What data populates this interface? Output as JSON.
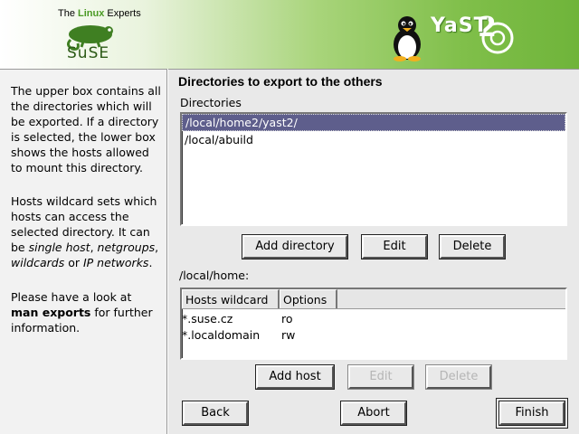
{
  "header": {
    "tagline_pre": "The ",
    "tagline_highlight": "Linux",
    "tagline_post": " Experts",
    "brand": "SuSE",
    "product": "YaST",
    "colors": {
      "accent": "#6fb43a",
      "selection": "#5e5e8c"
    }
  },
  "help": {
    "p1": "The upper box contains all the directories which will be exported. If a directory is selected, the lower box shows the hosts allowed to mount this directory.",
    "p2_pre": "Hosts wildcard sets which hosts can access the selected directory. It can be ",
    "p2_em1": "single host",
    "p2_sep1": ", ",
    "p2_em2": "netgroups",
    "p2_sep2": ", ",
    "p2_em3": "wildcards",
    "p2_sep3": " or ",
    "p2_em4": "IP networks",
    "p2_end": ".",
    "p3_pre": "Please have a look at ",
    "p3_bold": "man exports",
    "p3_post": " for further information."
  },
  "main": {
    "title": "Directories to export to the others",
    "dirs_label": "Directories",
    "directories": [
      "/local/home2/yast2/",
      "/local/abuild"
    ],
    "selected_index": 0,
    "buttons_dir": {
      "add": "Add directory",
      "edit": "Edit",
      "delete": "Delete"
    },
    "hosts_label": "/local/home:",
    "hosts_columns": [
      "Hosts wildcard",
      "Options"
    ],
    "hosts": [
      {
        "wildcard": "*.suse.cz",
        "options": "ro"
      },
      {
        "wildcard": "*.localdomain",
        "options": "rw"
      }
    ],
    "buttons_host": {
      "add": "Add host",
      "edit": "Edit",
      "delete": "Delete"
    },
    "nav": {
      "back": "Back",
      "abort": "Abort",
      "finish": "Finish"
    }
  }
}
